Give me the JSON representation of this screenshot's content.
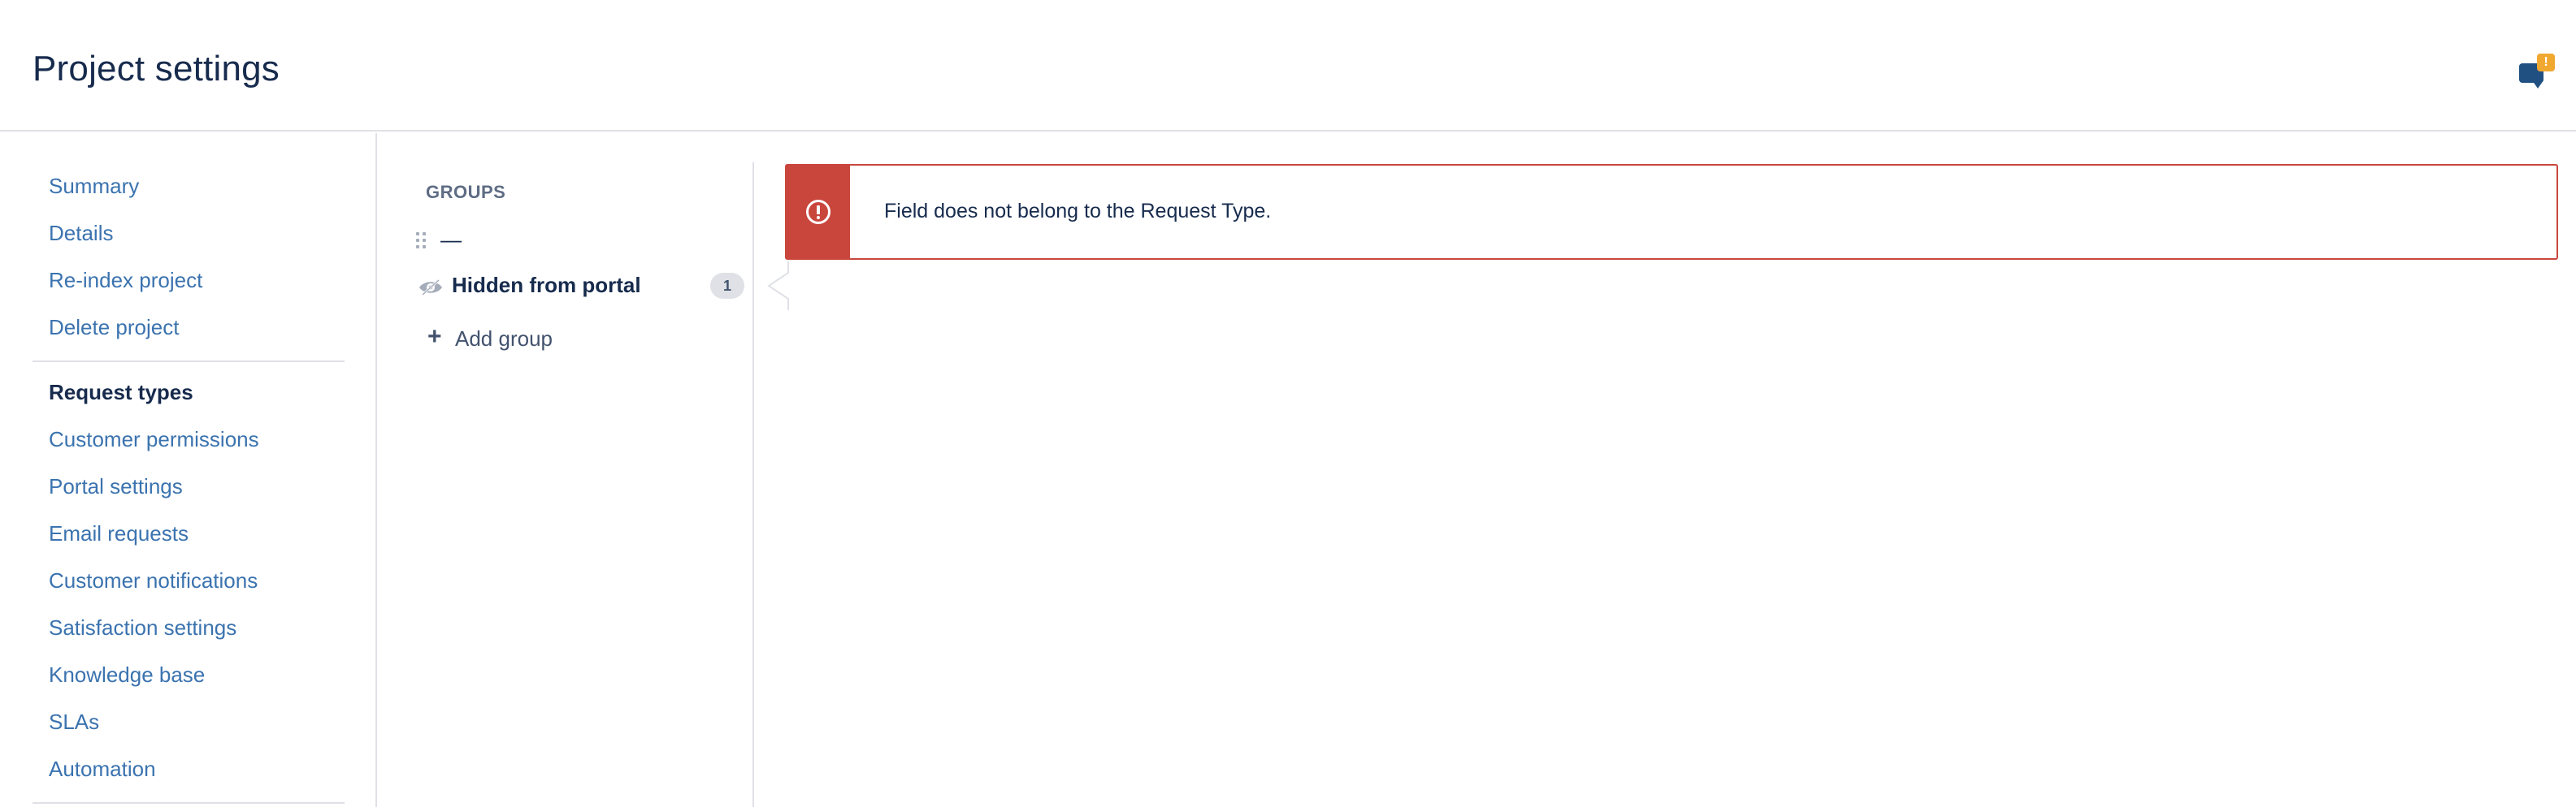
{
  "header": {
    "title": "Project settings",
    "feedback_badge": "!",
    "feedback_icon": "feedback-speech-bubble-icon",
    "brand_color": "#205081",
    "badge_color": "#f0a830"
  },
  "sidebar": {
    "items": [
      {
        "label": "Summary"
      },
      {
        "label": "Details"
      },
      {
        "label": "Re-index project"
      },
      {
        "label": "Delete project"
      },
      {
        "label": "Request types",
        "active": true
      },
      {
        "label": "Customer permissions"
      },
      {
        "label": "Portal settings"
      },
      {
        "label": "Email requests"
      },
      {
        "label": "Customer notifications"
      },
      {
        "label": "Satisfaction settings"
      },
      {
        "label": "Knowledge base"
      },
      {
        "label": "SLAs"
      },
      {
        "label": "Automation"
      }
    ],
    "link_color": "#3b73af"
  },
  "groups": {
    "heading": "GROUPS",
    "placeholder_text": "—",
    "items": [
      {
        "label": "Hidden from portal",
        "count": "1",
        "icon": "eye-hidden-icon"
      }
    ],
    "add_label": "Add group"
  },
  "error": {
    "message": "Field does not belong to the Request Type.",
    "icon": "error-circle-icon",
    "color": "#c9463d"
  }
}
